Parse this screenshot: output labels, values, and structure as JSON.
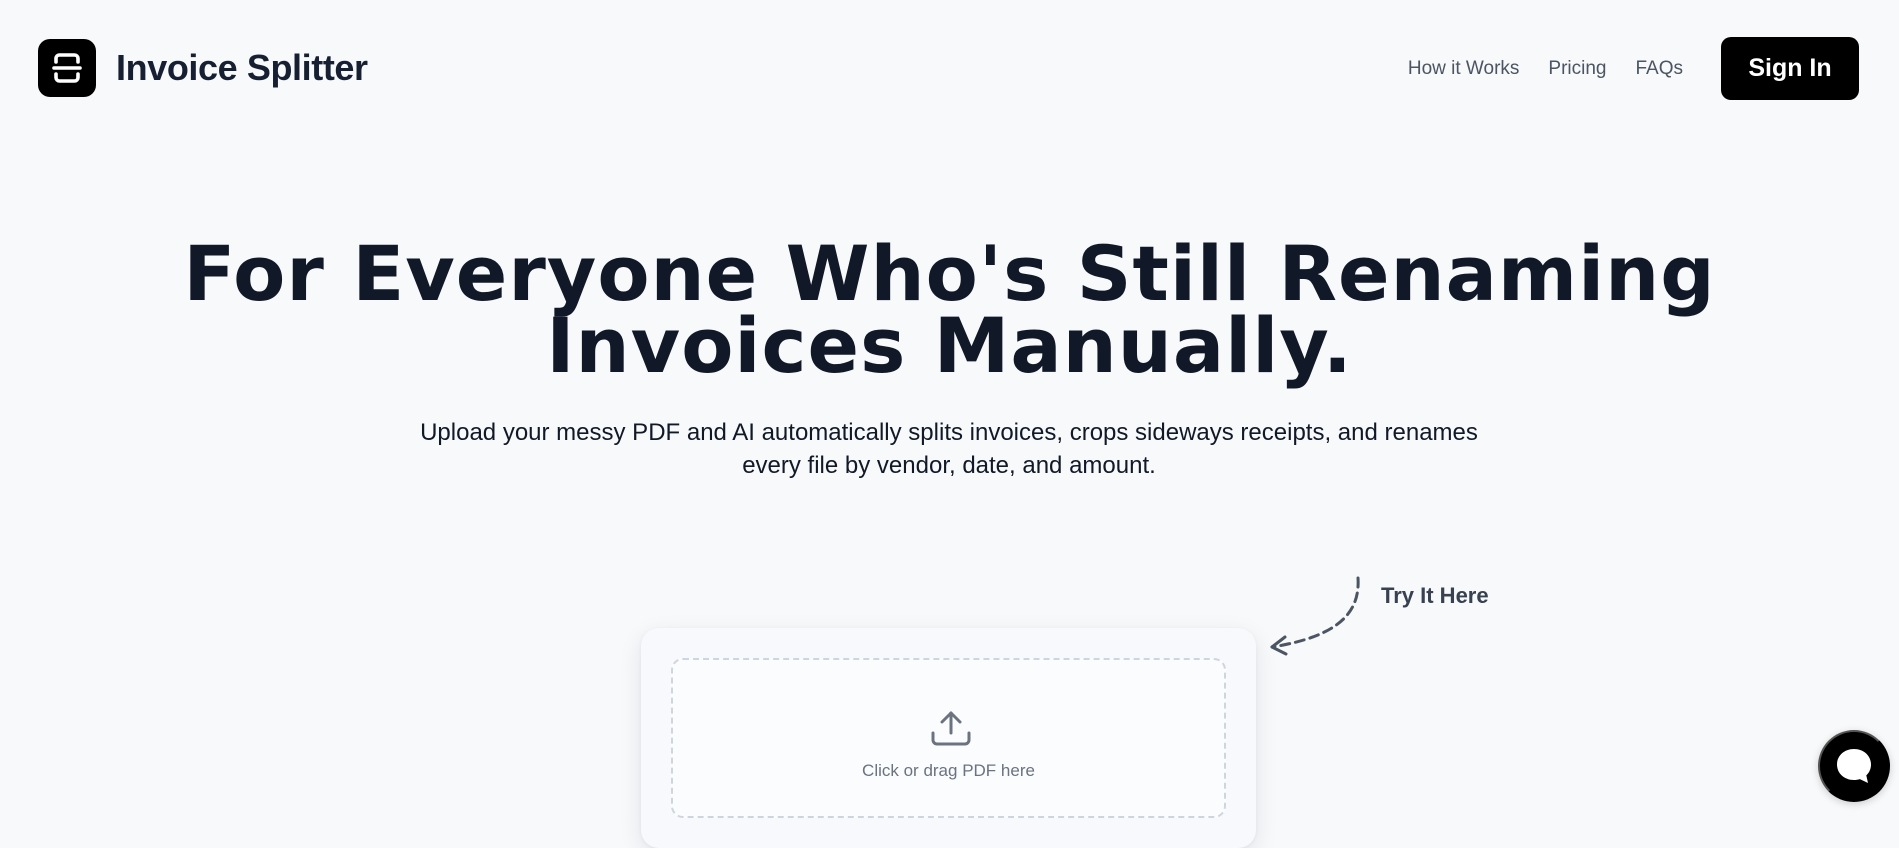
{
  "header": {
    "logo_icon": "scan-document-icon",
    "brand": "Invoice Splitter",
    "nav": [
      {
        "label": "How it Works"
      },
      {
        "label": "Pricing"
      },
      {
        "label": "FAQs"
      }
    ],
    "sign_in": "Sign In"
  },
  "hero": {
    "title_line_1": "For Everyone Who's Still Renaming",
    "title_line_2": "Invoices Manually.",
    "subtitle_line_1": "Upload your messy PDF and AI automatically splits invoices, crops sideways receipts, and renames",
    "subtitle_line_2": "every file by vendor, date, and amount."
  },
  "try_it": {
    "label": "Try It Here",
    "arrow_icon": "curved-dashed-arrow-icon"
  },
  "upload": {
    "icon": "upload-icon",
    "text": "Click or drag PDF here"
  },
  "chat": {
    "icon": "chat-bubble-icon"
  },
  "colors": {
    "background": "#f8f9fb",
    "text": "#111827",
    "muted_text": "#4b5563",
    "button": "#000000",
    "border": "#cfd5df"
  }
}
